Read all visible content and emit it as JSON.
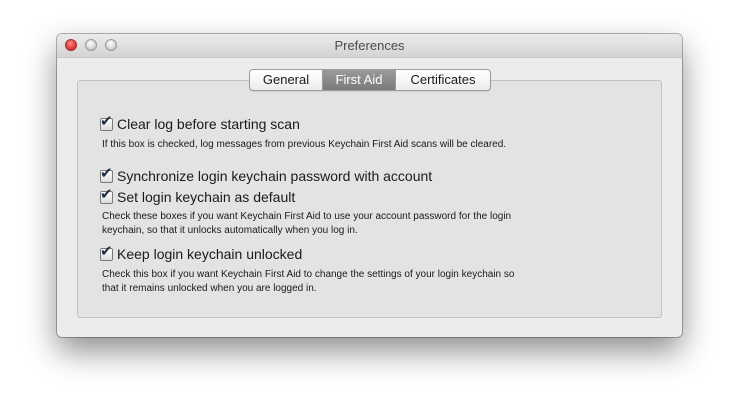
{
  "window": {
    "title": "Preferences"
  },
  "tabs": [
    {
      "label": "General",
      "selected": false
    },
    {
      "label": "First Aid",
      "selected": true
    },
    {
      "label": "Certificates",
      "selected": false
    }
  ],
  "options": {
    "clear_log": {
      "label": "Clear log before starting scan",
      "checked": true,
      "description": "If this box is checked, log messages from previous Keychain First Aid scans will be cleared."
    },
    "sync_password": {
      "label": "Synchronize login keychain password with account",
      "checked": true
    },
    "set_default": {
      "label": "Set login keychain as default",
      "checked": true,
      "description_line1": "Check these boxes if you want Keychain First Aid to use your account password for the login",
      "description_line2": "keychain, so that it unlocks automatically when you log in."
    },
    "keep_unlocked": {
      "label": "Keep login keychain unlocked",
      "checked": true,
      "description_line1": "Check this box if you want Keychain First Aid to change the settings of your login keychain so",
      "description_line2": "that it remains unlocked when you are logged in."
    }
  },
  "glyphs": {
    "checkmark": "✔"
  },
  "colors": {
    "close_button": "#e5413a",
    "selected_tab": "#7a7a7a"
  }
}
